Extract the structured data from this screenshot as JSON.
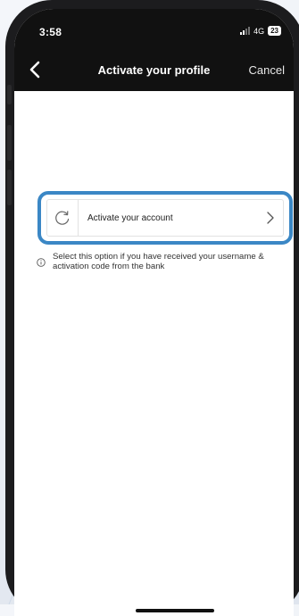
{
  "status": {
    "time": "3:58",
    "network": "4G",
    "battery": "23"
  },
  "nav": {
    "title": "Activate your profile",
    "cancel_label": "Cancel"
  },
  "option": {
    "label": "Activate your account"
  },
  "info": {
    "text": "Select this option if you have received your username & activation code from the bank"
  },
  "icons": {
    "back": "chevron-left-icon",
    "option": "refresh-icon",
    "chevron": "chevron-right-icon",
    "info": "info-icon"
  },
  "colors": {
    "header": "#111111",
    "highlight": "#3b87c5",
    "background": "#ffffff"
  }
}
